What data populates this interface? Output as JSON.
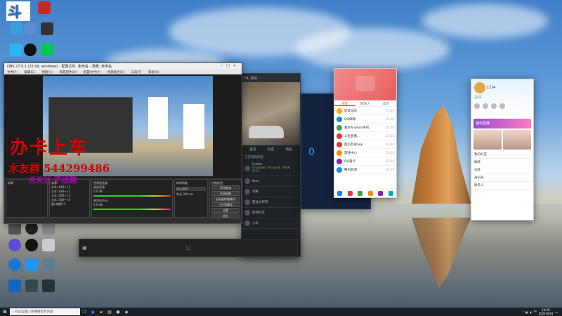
{
  "desktop": {
    "icons": [
      {
        "label": "",
        "color": "#2b6fd6"
      },
      {
        "label": "",
        "color": "#c62828"
      },
      {
        "label": "",
        "color": "#3a9fe0"
      },
      {
        "label": "",
        "color": "#4caf50"
      },
      {
        "label": "",
        "color": "#29b6f6"
      },
      {
        "label": "",
        "color": "#e53935"
      },
      {
        "label": "",
        "color": "#43a047"
      }
    ],
    "left_icons_lower": [
      {
        "label": "Windows",
        "color": "#555"
      },
      {
        "label": "OBS Studio",
        "color": "#222"
      },
      {
        "label": "",
        "color": "#888"
      },
      {
        "label": "",
        "color": "#5b4bd6"
      },
      {
        "label": "",
        "color": "#111"
      },
      {
        "label": "",
        "color": "#ccc"
      },
      {
        "label": "",
        "color": "#1976d2"
      },
      {
        "label": "",
        "color": "#2196f3"
      },
      {
        "label": "",
        "color": "#607d8b"
      },
      {
        "label": "",
        "color": "#1565c0"
      },
      {
        "label": "",
        "color": "#37474f"
      },
      {
        "label": "",
        "color": "#263238"
      }
    ]
  },
  "obs": {
    "title": "OBS 27.0.1 (32 bit, windows) - 配置文件: 未命名 - 场景: 未命名",
    "menu": [
      "文件(F)",
      "编辑(E)",
      "视图(V)",
      "停靠部件(D)",
      "配置文件(P)",
      "场景集合(S)",
      "工具(T)",
      "帮助(H)"
    ],
    "docks": {
      "scenes_title": "场景",
      "sources_title": "来源",
      "sources": [
        "文本 (GDI+) 1",
        "文本 (GDI+) 2",
        "文本 (GDI+) 3",
        "文本 (GDI+) 4",
        "窗口捕获 2"
      ],
      "mixer_title": "音频混音器",
      "mixer_channels": [
        "桌面音频",
        "麦克风/Aux"
      ],
      "mixer_levels": [
        "0.0 dB",
        "0.0 dB"
      ],
      "transition_title": "转场特效",
      "transition_value": "淡入淡出",
      "duration_label": "时长",
      "duration_value": "300 ms",
      "controls_title": "控制按钮",
      "controls": [
        "开始推流",
        "开始录制",
        "启动虚拟摄像机",
        "工作室模式",
        "设置",
        "退出"
      ]
    }
  },
  "overlay": {
    "line1": "办卡上车",
    "line2": "水友群 544299486",
    "line3": "点关注 不迷路"
  },
  "game": {
    "header": "Hi, 你好",
    "section_title": "正在玩的好友",
    "friends": [
      {
        "name": "Hutter",
        "status": "Changed: Kinsyall, ASIA, 2:51"
      },
      {
        "name": "Bear",
        "status": ""
      },
      {
        "name": "邓鹏",
        "status": ""
      },
      {
        "name": "西北大作哥",
        "status": ""
      },
      {
        "name": "阿你打车",
        "status": ""
      },
      {
        "name": "小米",
        "status": ""
      }
    ],
    "tabs": [
      "首页",
      "好友",
      "动态"
    ]
  },
  "blue_panel": {
    "value": "0"
  },
  "chat": {
    "title": "消息",
    "tabs": [
      "消息",
      "联系人",
      "动态"
    ],
    "items": [
      {
        "name": "好友动态",
        "time": "14:28",
        "color": "#ffb300"
      },
      {
        "name": "QQ邮箱",
        "time": "14:18",
        "color": "#1e88e5"
      },
      {
        "name": "我的Android手机",
        "time": "14:18",
        "color": "#43a047"
      },
      {
        "name": "斗鱼直播...",
        "time": "14:18",
        "color": "#e53935"
      },
      {
        "name": "西瓜影视App",
        "time": "14:18",
        "color": "#e53935"
      },
      {
        "name": "游戏中心",
        "time": "14:18",
        "color": "#fb8c00"
      },
      {
        "name": "QQ看点",
        "time": "14:18",
        "color": "#8e24aa"
      },
      {
        "name": "腾讯新闻",
        "time": "14:18",
        "color": "#1e88e5"
      }
    ]
  },
  "qq": {
    "user": "1234",
    "status": "在线",
    "banner": "福利直播",
    "lines": [
      "我的好友",
      "群聊",
      "设备",
      "通讯录",
      "联系人"
    ]
  },
  "taskbar": {
    "search_placeholder": "在这里输入你要搜索的内容",
    "time": "14:29",
    "date": "2021/8/24",
    "lang": "中"
  }
}
